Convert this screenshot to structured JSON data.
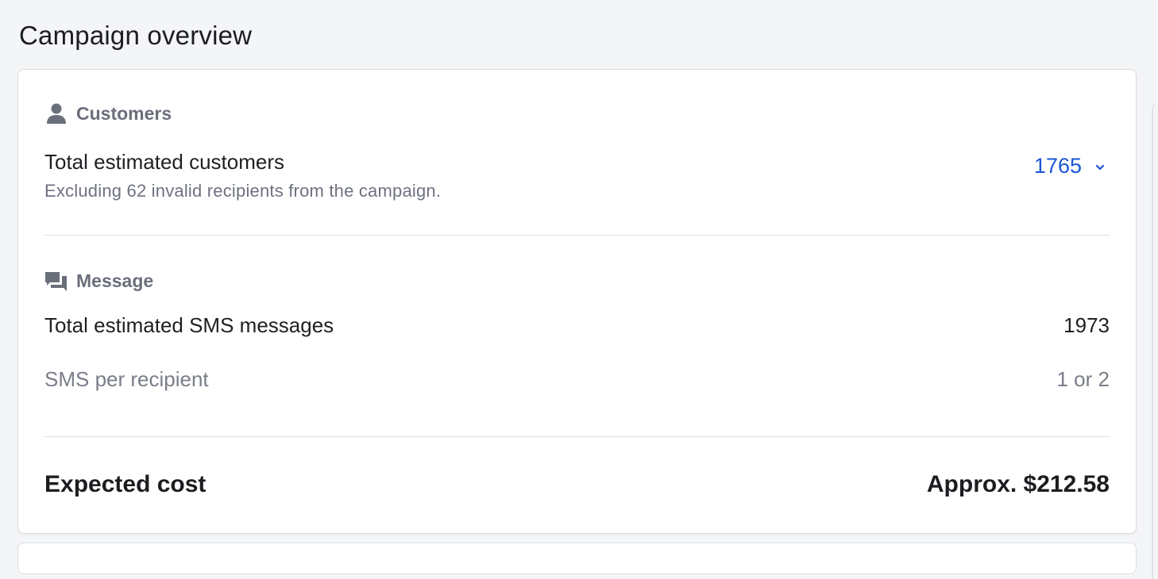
{
  "page": {
    "title": "Campaign overview"
  },
  "customers": {
    "header": "Customers",
    "icon": "person-icon",
    "total_label": "Total estimated customers",
    "total_note": "Excluding 62 invalid recipients from the campaign.",
    "total_value": "1765",
    "toggle_icon": "chevron-down-icon"
  },
  "message": {
    "header": "Message",
    "icon": "chat-bubbles-icon",
    "sms_total_label": "Total estimated SMS messages",
    "sms_total_value": "1973",
    "sms_per_label": "SMS per recipient",
    "sms_per_value": "1 or 2"
  },
  "cost": {
    "label": "Expected cost",
    "value": "Approx. $212.58"
  },
  "colors": {
    "accent": "#1a56d6",
    "muted_text": "#6e7280",
    "background": "#f4f5f7"
  }
}
